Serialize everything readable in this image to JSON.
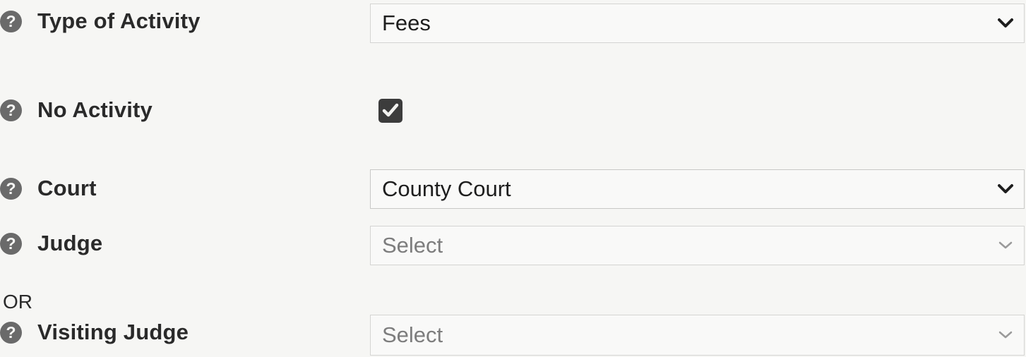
{
  "fields": {
    "type_of_activity": {
      "label": "Type of Activity",
      "value": "Fees"
    },
    "no_activity": {
      "label": "No Activity",
      "checked": true
    },
    "court": {
      "label": "Court",
      "value": "County Court"
    },
    "judge": {
      "label": "Judge",
      "value": "Select"
    },
    "or_text": "OR",
    "visiting_judge": {
      "label": "Visiting Judge",
      "value": "Select"
    }
  },
  "icons": {
    "help": "question-circle-icon",
    "dropdown": "chevron-down-icon",
    "check": "checkmark-icon"
  },
  "colors": {
    "background": "#f6f6f4",
    "text": "#2b2b2b",
    "disabled_text": "#7d7d7d",
    "icon": "#6a6a6a"
  }
}
